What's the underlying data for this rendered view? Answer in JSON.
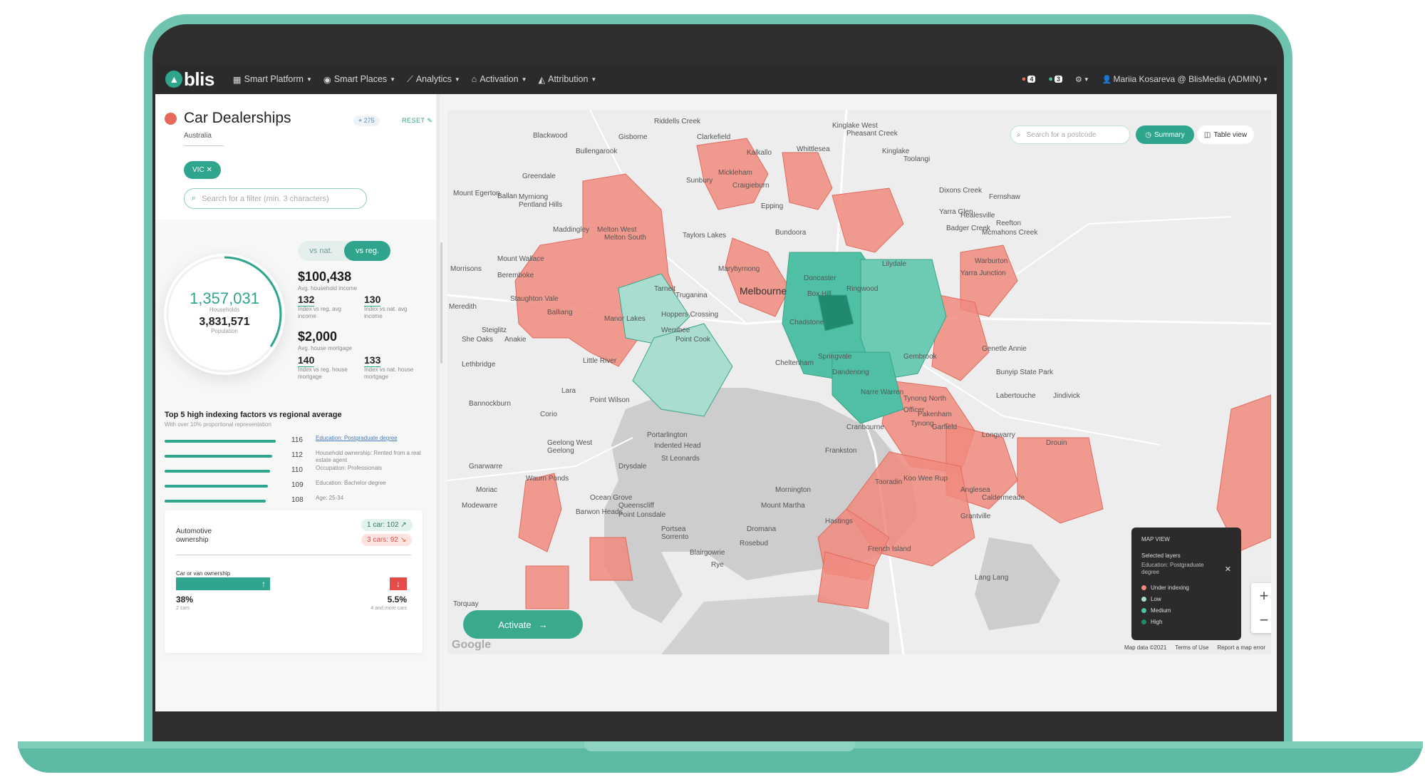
{
  "nav": {
    "logo_text": "blis",
    "items": [
      {
        "label": "Smart Platform"
      },
      {
        "label": "Smart Places"
      },
      {
        "label": "Analytics"
      },
      {
        "label": "Activation"
      },
      {
        "label": "Attribution"
      }
    ],
    "notif1_count": "4",
    "notif2_count": "3",
    "user": "Mariia Kosareva @ BlisMedia (ADMIN)"
  },
  "sidebar": {
    "title": "Car Dealerships",
    "subtitle": "Australia",
    "count": "275",
    "reset": "RESET",
    "filter_chip": "VIC",
    "filter_search_placeholder": "Search for a filter (min. 3 characters)",
    "toggle_nat": "vs nat.",
    "toggle_reg": "vs reg.",
    "households_value": "1,357,031",
    "households_label": "Households",
    "population_value": "3,831,571",
    "population_label": "Population",
    "income": {
      "value": "$100,438",
      "label": "Avg. household income"
    },
    "income_index_reg": {
      "value": "132",
      "label": "Index vs reg. avg income"
    },
    "income_index_nat": {
      "value": "130",
      "label": "Index vs nat. avg income"
    },
    "mortgage": {
      "value": "$2,000",
      "label": "Avg. house mortgage"
    },
    "mortgage_index_reg": {
      "value": "140",
      "label": "Index vs reg. house mortgage"
    },
    "mortgage_index_nat": {
      "value": "133",
      "label": "Index vs nat. house mortgage"
    },
    "top5_title": "Top 5 high indexing factors vs regional average",
    "top5_subtitle": "With over 10% proportional representation",
    "factors": [
      {
        "value": "116",
        "label": "Education: Postgraduate degree",
        "bar_fraction": 1.0
      },
      {
        "value": "112",
        "label": "Household ownership: Rented from a real estate agent",
        "bar_fraction": 0.97
      },
      {
        "value": "110",
        "label": "Occupation: Professionals",
        "bar_fraction": 0.95
      },
      {
        "value": "109",
        "label": "Education: Bachelor degree",
        "bar_fraction": 0.93
      },
      {
        "value": "108",
        "label": "Age: 25-34",
        "bar_fraction": 0.91
      }
    ],
    "automotive": {
      "title": "Automotive ownership",
      "chip_1car": "1 car: 102",
      "chip_3cars": "3 cars: 92",
      "sub_title": "Car or van ownership",
      "left_pct": "38%",
      "left_label": "2 cars",
      "right_pct": "5.5%",
      "right_label": "4 and more cars"
    }
  },
  "map": {
    "search_placeholder": "Search for a postcode",
    "summary_label": "Summary",
    "table_label": "Table view",
    "activate_label": "Activate",
    "labels": [
      "Riddells Creek",
      "Clarkefield",
      "Gisborne",
      "Blackwood",
      "Bullengarook",
      "Sunbury",
      "Mickleham",
      "Kalkallo",
      "Whittlesea",
      "Kinglake West",
      "Pheasant Creek",
      "Kinglake",
      "Toolangi",
      "Craigieburn",
      "Epping",
      "Greendale",
      "Ballan",
      "Myrniong",
      "Pentland Hills",
      "Melton West",
      "Melton South",
      "Maddingley",
      "Taylors Lakes",
      "Bundoora",
      "Dixons Creek",
      "Fernshaw",
      "Yarra Glen",
      "Healesville",
      "Badger Creek",
      "Reefton",
      "Mcmahons Creek",
      "Mount Egerton",
      "Morrisons",
      "Mount Wallace",
      "Beremboke",
      "Staughton Vale",
      "Balliang",
      "Tarneit",
      "Truganina",
      "Marybyrnong",
      "Melbourne",
      "Doncaster",
      "Box Hill",
      "Ringwood",
      "Lilydale",
      "Warburton",
      "Yarra Junction",
      "Meredith",
      "Steiglitz",
      "Anakie",
      "Manor Lakes",
      "Werribee",
      "Hoppers Crossing",
      "Point Cook",
      "Chadstone",
      "Cheltenham",
      "Springvale",
      "Dandenong",
      "She Oaks",
      "Lethbridge",
      "Little River",
      "Lara",
      "Bannockburn",
      "Point Wilson",
      "Corio",
      "Geelong West",
      "Geelong",
      "Portarlington",
      "Indented Head",
      "St Leonards",
      "Drysdale",
      "Narre Warren",
      "Officer",
      "Pakenham",
      "Gembrook",
      "Tynong North",
      "Tynong",
      "Garfield",
      "Longwarry",
      "Labertouche",
      "Jindivick",
      "Bunyip State Park",
      "Genetle Annie",
      "Drouin",
      "Cranbourne",
      "Frankston",
      "Mornington",
      "Tooradin",
      "Koo Wee Rup",
      "Waurn Ponds",
      "Moriac",
      "Gnarwarre",
      "Modewarre",
      "Ocean Grove",
      "Barwon Heads",
      "Point Lonsdale",
      "Queenscliff",
      "Portsea",
      "Sorrento",
      "Blairgowrie",
      "Rosebud",
      "Dromana",
      "Mount Martha",
      "Rye",
      "Hastings",
      "French Island",
      "Torquay",
      "Anglesea",
      "Caldermeade",
      "Lang Lang",
      "Grantville",
      "Yarra Junction"
    ],
    "legend": {
      "title": "MAP VIEW",
      "layers_title": "Selected layers",
      "layer_name": "Education: Postgraduate degree",
      "items": [
        {
          "label": "Under indexing",
          "color": "#f08a7e"
        },
        {
          "label": "Low",
          "color": "#a9ddd0"
        },
        {
          "label": "Medium",
          "color": "#4fc0a5"
        },
        {
          "label": "High",
          "color": "#1f8a70"
        }
      ]
    },
    "footer": [
      "Map data ©2021",
      "Terms of Use",
      "Report a map error"
    ],
    "google_text": "Google"
  },
  "colors": {
    "accent": "#2fa58d",
    "under": "#f08a7e",
    "danger": "#e54b4b"
  }
}
